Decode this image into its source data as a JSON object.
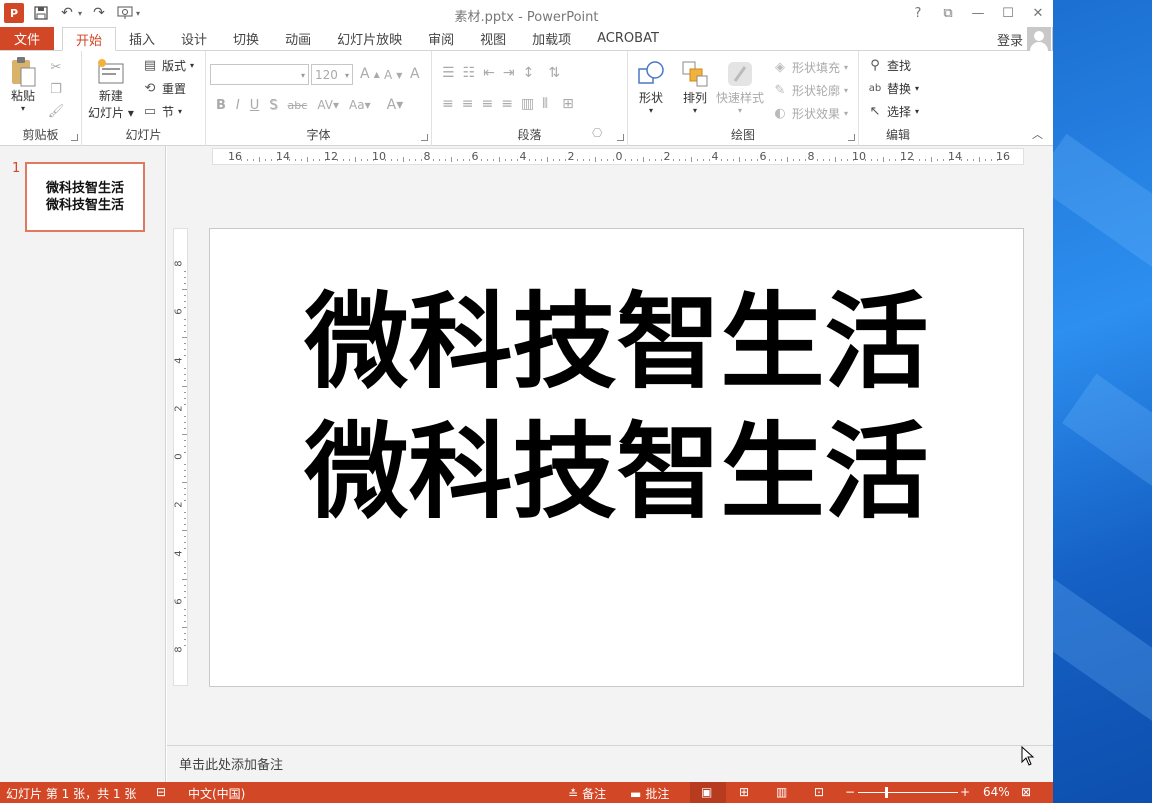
{
  "window": {
    "title": "素材.pptx - PowerPoint",
    "app_logo": "P",
    "controls": [
      "?",
      "⧉",
      "—",
      "☐",
      "✕"
    ]
  },
  "tabs": {
    "file": "文件",
    "items": [
      "开始",
      "插入",
      "设计",
      "切换",
      "动画",
      "幻灯片放映",
      "审阅",
      "视图",
      "加载项",
      "ACROBAT"
    ],
    "active": "开始",
    "login": "登录"
  },
  "ribbon": {
    "clipboard": {
      "label": "剪贴板",
      "paste": "粘贴"
    },
    "slides": {
      "label": "幻灯片",
      "new_slide_line1": "新建",
      "new_slide_line2": "幻灯片",
      "layout": "版式",
      "reset": "重置",
      "section": "节"
    },
    "font": {
      "label": "字体",
      "font_name": "",
      "font_size": "120",
      "grow": "A",
      "shrink": "A",
      "clear": "A",
      "bold": "B",
      "italic": "I",
      "underline": "U",
      "shadow": "S",
      "strike": "abc",
      "spacing": "AV",
      "case": "Aa",
      "color": "A"
    },
    "paragraph": {
      "label": "段落"
    },
    "drawing": {
      "label": "绘图",
      "shapes": "形状",
      "arrange": "排列",
      "quick_styles": "快速样式",
      "fill": "形状填充",
      "outline": "形状轮廓",
      "effects": "形状效果"
    },
    "editing": {
      "label": "编辑",
      "find": "查找",
      "replace": "替换",
      "select": "选择"
    }
  },
  "thumbnails": [
    {
      "number": "1",
      "line1": "微科技智生活",
      "line2": "微科技智生活"
    }
  ],
  "slide": {
    "line1": "微科技智生活",
    "line2": "微科技智生活"
  },
  "rulers": {
    "horizontal": [
      "16",
      "14",
      "12",
      "10",
      "8",
      "6",
      "4",
      "2",
      "0",
      "2",
      "4",
      "6",
      "8",
      "10",
      "12",
      "14",
      "16"
    ],
    "vertical": [
      "8",
      "6",
      "4",
      "2",
      "0",
      "2",
      "4",
      "6",
      "8"
    ]
  },
  "notes": {
    "placeholder": "单击此处添加备注"
  },
  "status": {
    "slide_info": "幻灯片 第 1 张，共 1 张",
    "language": "中文(中国)",
    "notes": "备注",
    "comments": "批注",
    "zoom": "64%",
    "zoom_level": 0.64
  },
  "colors": {
    "accent": "#d24726",
    "desktop": "#1c6fd0"
  }
}
